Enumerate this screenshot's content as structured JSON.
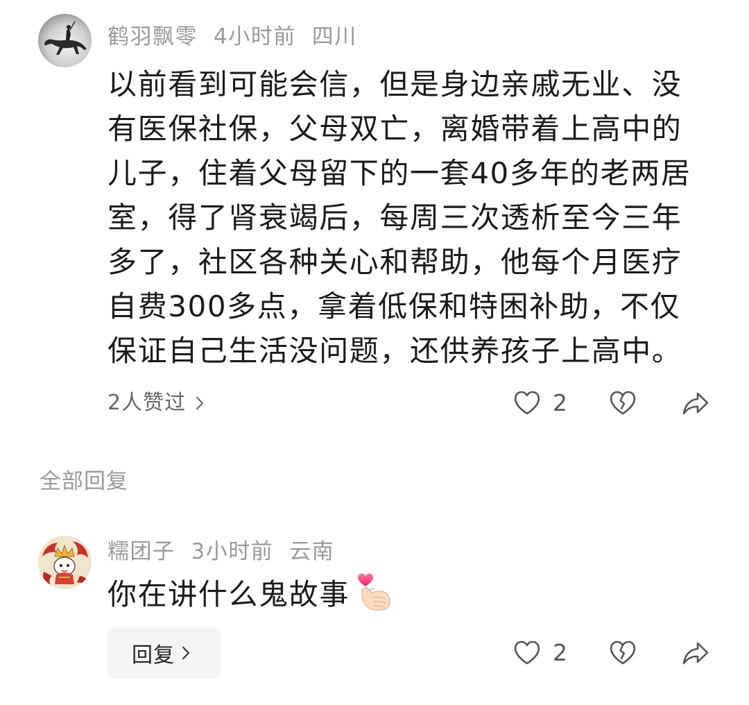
{
  "thread": {
    "comment": {
      "avatar_icon": "user-avatar-horse-rider",
      "username": "鹤羽飘零",
      "time": "4小时前",
      "location": "四川",
      "text_lines": [
        "以前看到可能会信，但是身边亲戚无业、没",
        "有医保社保，父母双亡，离婚带着上高中的",
        "儿子，住着父母留下的一套40多年的老两居",
        "室，得了肾衰竭后，每周三次透析至今三年",
        "多了，社区各种关心和帮助，他每个月医疗",
        "自费300多点，拿着低保和特困补助，不仅",
        "保证自己生活没问题，还供养孩子上高中。"
      ],
      "likes_summary": "2人赞过",
      "like_count": "2",
      "icons": {
        "likes_more": "chevron-right-icon",
        "like": "heart-icon",
        "dislike": "broken-heart-icon",
        "share": "share-icon"
      }
    },
    "replies_header": "全部回复",
    "reply": {
      "avatar_icon": "user-avatar-cartoon",
      "username": "糯团子",
      "time": "3小时前",
      "location": "云南",
      "text": "你在讲什么鬼故事",
      "emoji": "finger-heart-emoji",
      "reply_button_label": "回复",
      "like_count": "2",
      "icons": {
        "reply_more": "chevron-right-icon",
        "like": "heart-icon",
        "dislike": "broken-heart-icon",
        "share": "share-icon"
      }
    }
  },
  "colors": {
    "meta_text": "#999999",
    "body_text": "#1a1a1a",
    "summary_text": "#666666",
    "count_text": "#555555",
    "icon_stroke": "#555555",
    "button_bg": "#f4f4f4"
  }
}
